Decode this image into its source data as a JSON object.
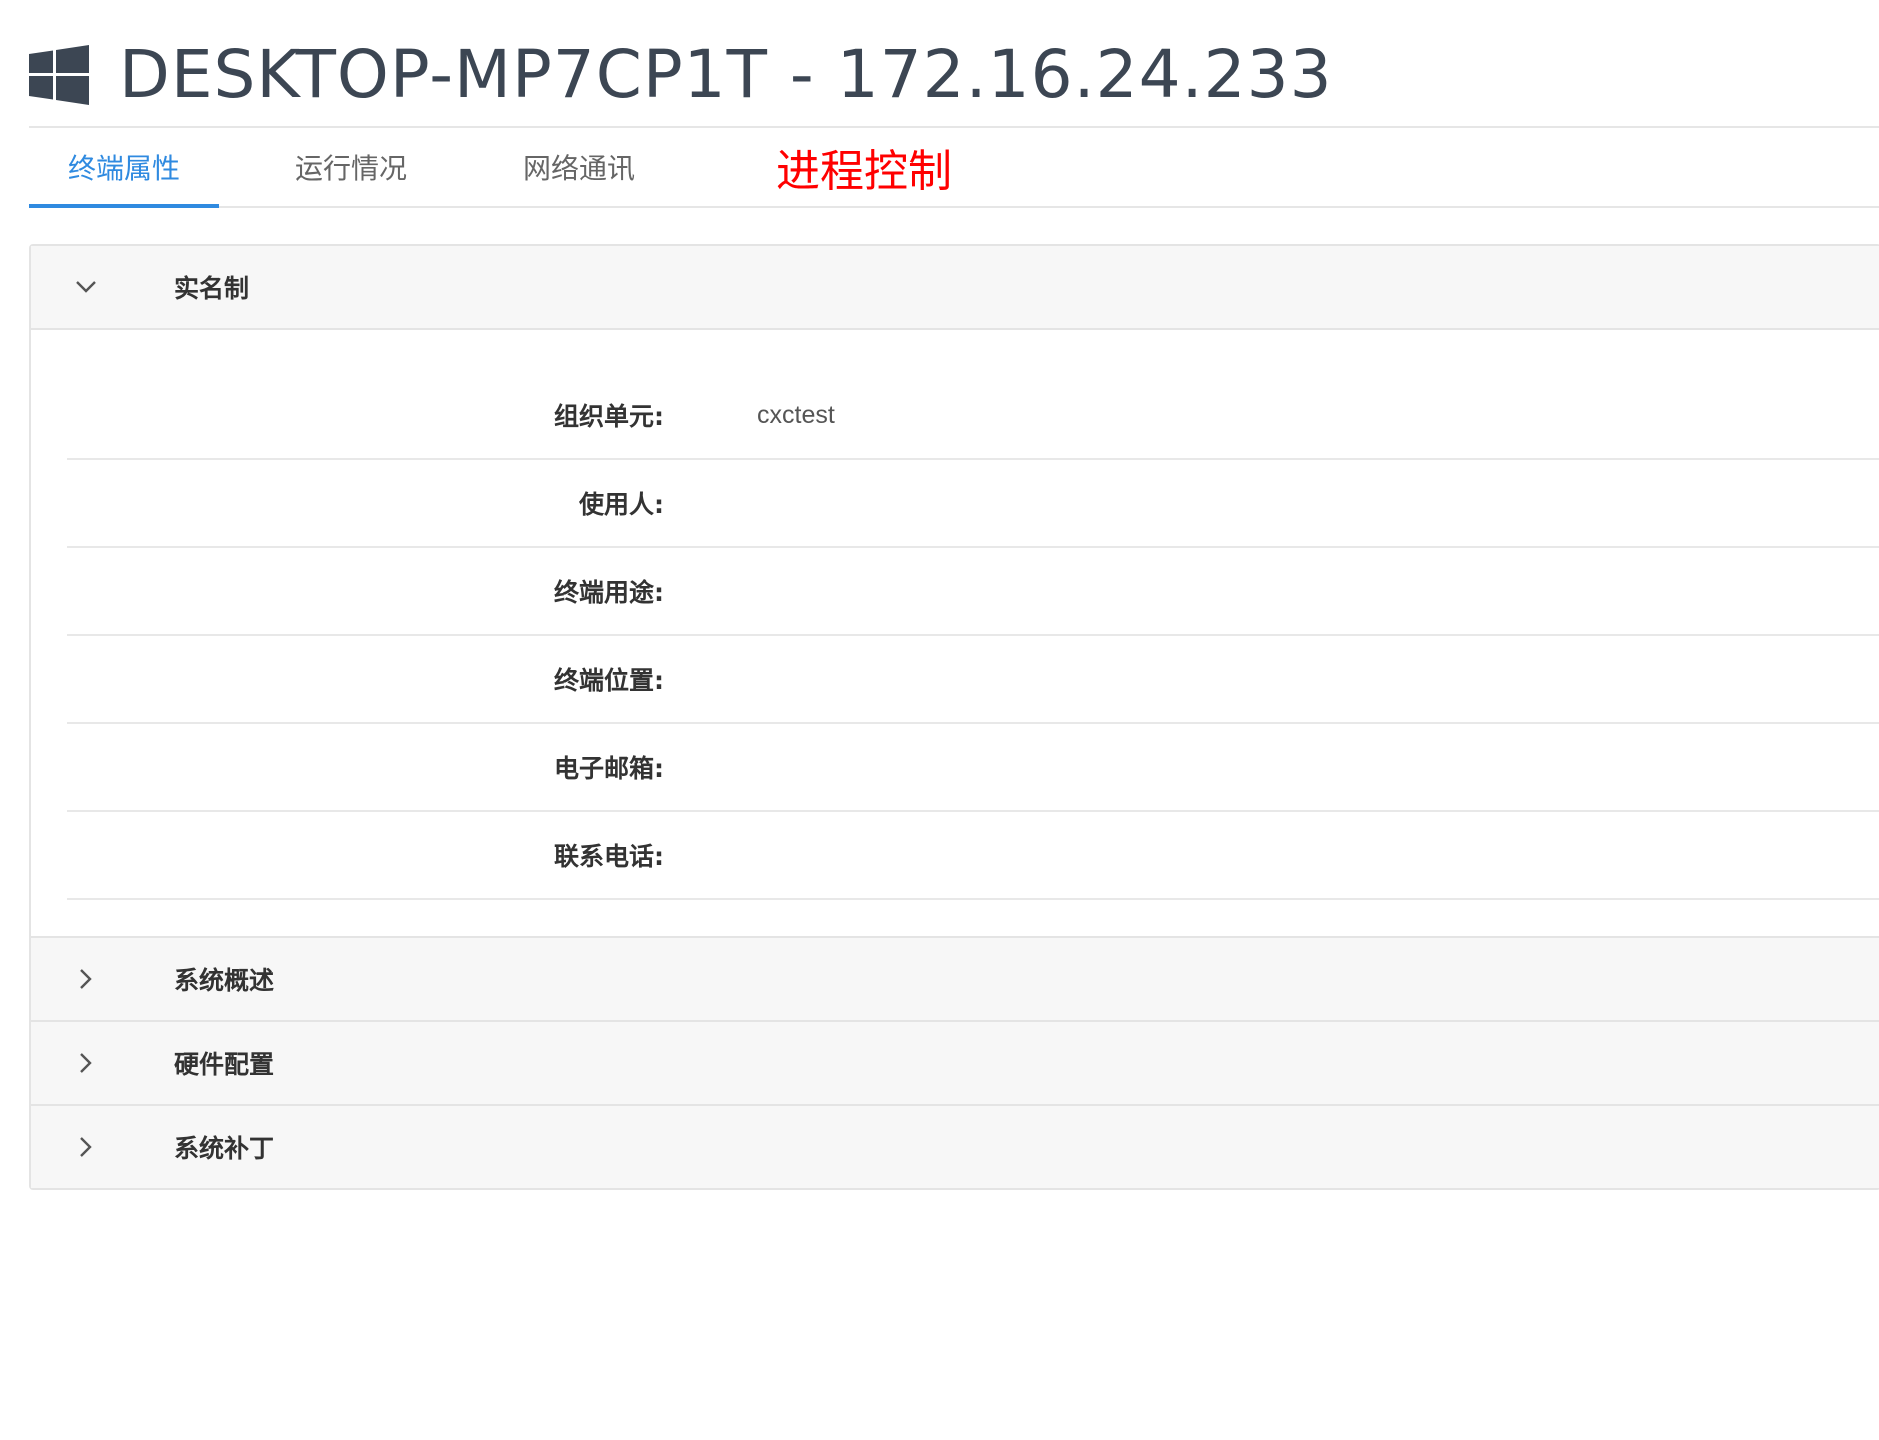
{
  "header": {
    "icon": "windows-icon",
    "title": "DESKTOP-MP7CP1T - 172.16.24.233"
  },
  "tabs": [
    {
      "label": "终端属性",
      "active": true
    },
    {
      "label": "运行情况",
      "active": false
    },
    {
      "label": "网络通讯",
      "active": false
    },
    {
      "label": "进程控制",
      "active": false
    }
  ],
  "sections": {
    "realname": {
      "title": "实名制",
      "expanded": true,
      "fields": [
        {
          "label": "组织单元:",
          "value": "cxctest"
        },
        {
          "label": "使用人:",
          "value": ""
        },
        {
          "label": "终端用途:",
          "value": ""
        },
        {
          "label": "终端位置:",
          "value": ""
        },
        {
          "label": "电子邮箱:",
          "value": ""
        },
        {
          "label": "联系电话:",
          "value": ""
        }
      ]
    },
    "overview": {
      "title": "系统概述",
      "expanded": false
    },
    "hardware": {
      "title": "硬件配置",
      "expanded": false
    },
    "patches": {
      "title": "系统补丁",
      "expanded": false
    }
  },
  "colors": {
    "accent": "#2f8ae0",
    "highlight_tab": "#ff0000",
    "title": "#3c4653",
    "section_header_bg": "#f7f7f7"
  }
}
